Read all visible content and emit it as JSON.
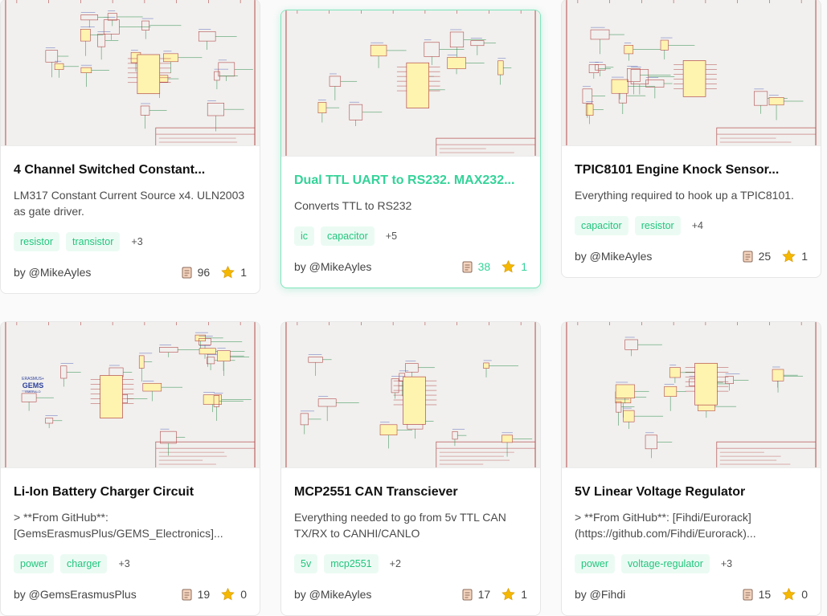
{
  "cards": [
    {
      "title": "4 Channel Switched Constant...",
      "description": "LM317 Constant Current Source x4. ULN2003 as gate driver.",
      "tags": [
        "resistor",
        "transistor"
      ],
      "more": "+3",
      "author": "by @MikeAyles",
      "files": "96",
      "stars": "1",
      "hovered": false
    },
    {
      "title": "Dual TTL UART to RS232. MAX232...",
      "description": "Converts TTL to RS232",
      "tags": [
        "ic",
        "capacitor"
      ],
      "more": "+5",
      "author": "by @MikeAyles",
      "files": "38",
      "stars": "1",
      "hovered": true
    },
    {
      "title": "TPIC8101 Engine Knock Sensor...",
      "description": "Everything required to hook up a TPIC8101.",
      "tags": [
        "capacitor",
        "resistor"
      ],
      "more": "+4",
      "author": "by @MikeAyles",
      "files": "25",
      "stars": "1",
      "hovered": false
    },
    {
      "title": "Li-Ion Battery Charger Circuit",
      "description": "> **From GitHub**: [GemsErasmusPlus/GEMS_Electronics]...",
      "tags": [
        "power",
        "charger"
      ],
      "more": "+3",
      "author": "by @GemsErasmusPlus",
      "files": "19",
      "stars": "0",
      "hovered": false,
      "logo_text": [
        "ERASMUS+",
        "GEMS",
        "EMERALD"
      ]
    },
    {
      "title": "MCP2551 CAN Transciever",
      "description": "Everything needed to go from 5v TTL CAN TX/RX to CANHI/CANLO",
      "tags": [
        "5v",
        "mcp2551"
      ],
      "more": "+2",
      "author": "by @MikeAyles",
      "files": "17",
      "stars": "1",
      "hovered": false
    },
    {
      "title": "5V Linear Voltage Regulator",
      "description": "> **From GitHub**: [Fihdi/Eurorack] (https://github.com/Fihdi/Eurorack)...",
      "tags": [
        "power",
        "voltage-regulator"
      ],
      "more": "+3",
      "author": "by @Fihdi",
      "files": "15",
      "stars": "0",
      "hovered": false
    }
  ],
  "colors": {
    "accent": "#34d399",
    "tag_bg": "#ebfbf3",
    "tag_text": "#22c57e",
    "schematic_red": "#b24a4a",
    "star": "#f5b800"
  }
}
